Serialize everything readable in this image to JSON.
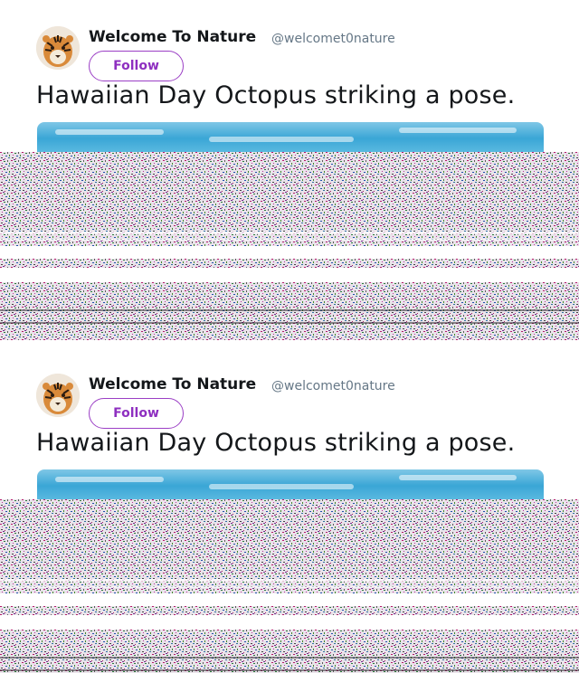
{
  "tweets": [
    {
      "author_name": "Welcome To Nature",
      "author_handle": "@welcomet0nature",
      "follow_label": "Follow",
      "text": "Hawaiian Day Octopus striking a pose."
    },
    {
      "author_name": "Welcome To Nature",
      "author_handle": "@welcomet0nature",
      "follow_label": "Follow",
      "text": "Hawaiian Day Octopus striking a pose."
    }
  ],
  "icons": {
    "avatar": "tiger-avatar",
    "follow": "follow-button",
    "media": "ocean-photo"
  },
  "colors": {
    "accent": "#8e2fc0",
    "name": "#14171a",
    "handle": "#657786",
    "media_water": "#3aa6d6"
  }
}
